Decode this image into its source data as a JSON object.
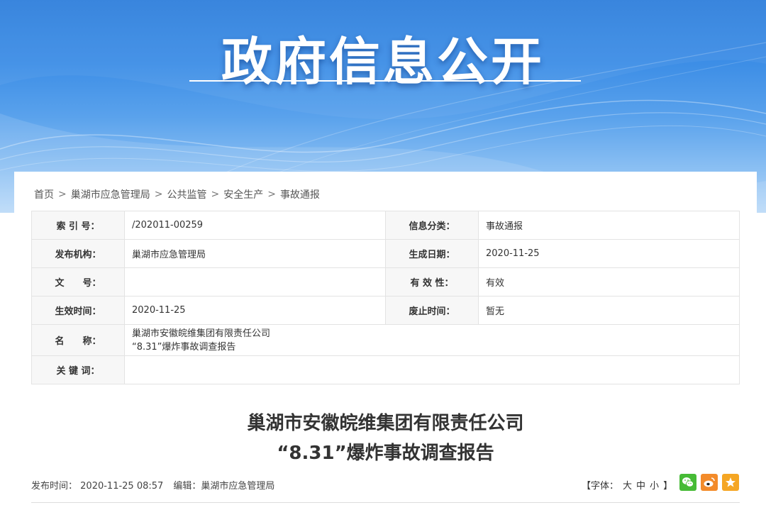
{
  "banner": {
    "title": "政府信息公开"
  },
  "breadcrumb": {
    "items": [
      "首页",
      "巢湖市应急管理局",
      "公共监管",
      "安全生产",
      "事故通报"
    ],
    "separator": ">"
  },
  "info_table": {
    "index_label": "索 引 号：",
    "index_value": "/202011-00259",
    "category_label": "信息分类：",
    "category_value": "事故通报",
    "publisher_label": "发布机构：",
    "publisher_value": "巢湖市应急管理局",
    "created_label": "生成日期：",
    "created_value": "2020-11-25",
    "doc_no_label": "文　　号：",
    "doc_no_value": "",
    "validity_label": "有 效 性：",
    "validity_value": "有效",
    "effective_label": "生效时间：",
    "effective_value": "2020-11-25",
    "expire_label": "废止时间：",
    "expire_value": "暂无",
    "name_label": "名　　称：",
    "name_line1": "巢湖市安徽皖维集团有限责任公司",
    "name_line2": "“8.31”爆炸事故调查报告",
    "keywords_label": "关 键 词：",
    "keywords_value": ""
  },
  "article": {
    "title_line1": "巢湖市安徽皖维集团有限责任公司",
    "title_line2": "“8.31”爆炸事故调查报告",
    "publish_label": "发布时间：",
    "publish_value": "2020-11-25 08:57",
    "editor_label": "编辑：",
    "editor_value": "巢湖市应急管理局"
  },
  "font_size": {
    "open": "【字体：",
    "large": "大",
    "medium": "中",
    "small": "小",
    "close": "】"
  },
  "share": {
    "icons": [
      "wechat-icon",
      "weibo-icon",
      "qzone-icon"
    ]
  },
  "colors": {
    "banner_blue": "#3d8ee6",
    "wechat": "#46bb36",
    "weibo": "#f38b2a",
    "qzone": "#f5a623"
  }
}
